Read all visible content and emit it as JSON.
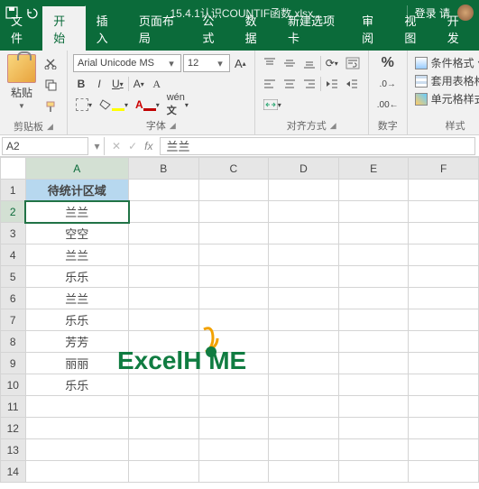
{
  "titlebar": {
    "filename": "15.4.1认识COUNTIF函数.xlsx...",
    "login": "登录 请"
  },
  "tabs": [
    "文件",
    "开始",
    "插入",
    "页面布局",
    "公式",
    "数据",
    "新建选项卡",
    "审阅",
    "视图",
    "开发"
  ],
  "active_tab": 1,
  "ribbon": {
    "clipboard": {
      "paste": "粘贴",
      "label": "剪贴板"
    },
    "font": {
      "name": "Arial Unicode MS",
      "size": "12",
      "label": "字体"
    },
    "align": {
      "label": "对齐方式"
    },
    "number": {
      "label": "数字",
      "percent": "%",
      "dec_inc": ".0",
      "dec_dec": ".00"
    },
    "styles": {
      "cond": "条件格式",
      "table": "套用表格格式",
      "cell": "单元格样式",
      "label": "样式"
    }
  },
  "formula_bar": {
    "cell_ref": "A2",
    "fx": "fx",
    "value": "兰兰"
  },
  "columns": [
    "A",
    "B",
    "C",
    "D",
    "E",
    "F"
  ],
  "chart_data": {
    "type": "table",
    "header": "待统计区域",
    "rows": [
      "兰兰",
      "空空",
      "兰兰",
      "乐乐",
      "兰兰",
      "乐乐",
      "芳芳",
      "丽丽",
      "乐乐"
    ]
  },
  "watermark": {
    "ex": "Ex",
    "cel": "cel",
    "home": "H   ME"
  }
}
